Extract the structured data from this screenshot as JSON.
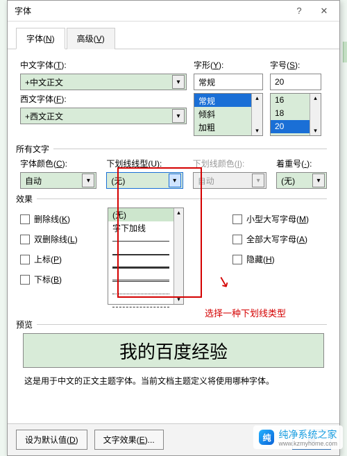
{
  "dialog": {
    "title": "字体",
    "help_icon": "?",
    "close_icon": "✕"
  },
  "tabs": {
    "font": {
      "label": "字体(",
      "access": "N",
      "suffix": ")"
    },
    "advanced": {
      "label": "高级(",
      "access": "V",
      "suffix": ")"
    }
  },
  "fields": {
    "chinese_font": {
      "label": "中文字体(",
      "access": "T",
      "suffix": "):",
      "value": "+中文正文"
    },
    "western_font": {
      "label": "西文字体(",
      "access": "F",
      "suffix": "):",
      "value": "+西文正文"
    },
    "font_style": {
      "label": "字形(",
      "access": "Y",
      "suffix": "):",
      "value": "常规",
      "options": [
        "常规",
        "倾斜",
        "加粗"
      ],
      "selected_index": 0
    },
    "font_size": {
      "label": "字号(",
      "access": "S",
      "suffix": "):",
      "value": "20",
      "options": [
        "16",
        "18",
        "20"
      ],
      "selected_index": 2
    }
  },
  "all_text_section": "所有文字",
  "color": {
    "label": "字体颜色(",
    "access": "C",
    "suffix": "):",
    "value": "自动"
  },
  "underline_style": {
    "label": "下划线线型(",
    "access": "U",
    "suffix": "):",
    "value": "(无)",
    "options": [
      "(无)",
      "字下加线",
      "solid-thin",
      "solid-med",
      "solid-thick",
      "double",
      "dotted",
      "dashed"
    ]
  },
  "underline_color": {
    "label": "下划线颜色(",
    "access": "I",
    "suffix": "):",
    "value": "自动"
  },
  "emphasis": {
    "label": "着重号(",
    "access": "·",
    "suffix": "):",
    "value": "(无)"
  },
  "effects_section": "效果",
  "effects": {
    "strike": {
      "label": "删除线(",
      "access": "K",
      "suffix": ")"
    },
    "dstrike": {
      "label": "双删除线(",
      "access": "L",
      "suffix": ")"
    },
    "superscript": {
      "label": "上标(",
      "access": "P",
      "suffix": ")"
    },
    "subscript": {
      "label": "下标(",
      "access": "B",
      "suffix": ")"
    },
    "smallcaps": {
      "label": "小型大写字母(",
      "access": "M",
      "suffix": ")"
    },
    "allcaps": {
      "label": "全部大写字母(",
      "access": "A",
      "suffix": ")"
    },
    "hidden": {
      "label": "隐藏(",
      "access": "H",
      "suffix": ")"
    }
  },
  "annotation": {
    "arrow": "↘",
    "text": "选择一种下划线类型"
  },
  "preview_section": "预览",
  "preview_text": "我的百度经验",
  "preview_note": "这是用于中文的正文主题字体。当前文档主题定义将使用哪种字体。",
  "footer": {
    "set_default": {
      "label": "设为默认值(",
      "access": "D",
      "suffix": ")"
    },
    "text_effects": {
      "label": "文字效果(",
      "access": "E",
      "suffix": ")..."
    },
    "ok": "确"
  },
  "watermark": {
    "brand": "纯净系统之家",
    "url": "www.kzmyhome.com"
  }
}
